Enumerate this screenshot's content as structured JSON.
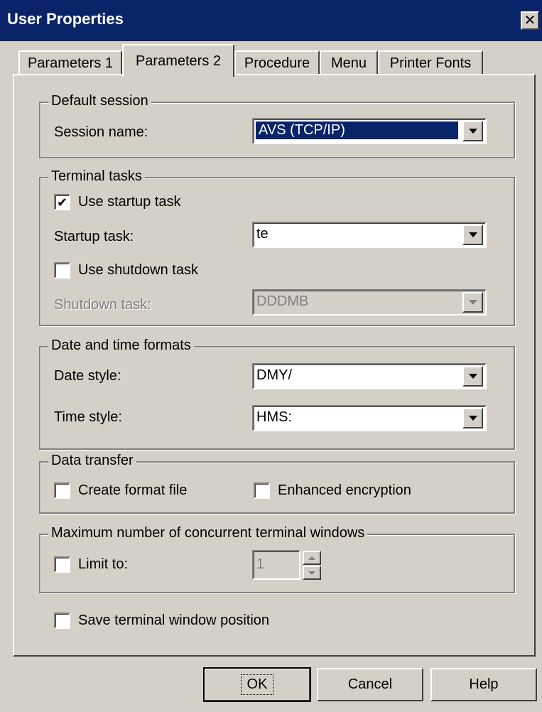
{
  "window": {
    "title": "User Properties",
    "close_glyph": "✕"
  },
  "tabs": [
    {
      "label": "Parameters 1",
      "active": false
    },
    {
      "label": "Parameters 2",
      "active": true
    },
    {
      "label": "Procedure",
      "active": false
    },
    {
      "label": "Menu",
      "active": false
    },
    {
      "label": "Printer Fonts",
      "active": false
    }
  ],
  "default_session": {
    "legend": "Default session",
    "session_name_label": "Session name:",
    "session_name_value": "AVS (TCP/IP)"
  },
  "terminal_tasks": {
    "legend": "Terminal tasks",
    "use_startup_task": {
      "label": "Use startup task",
      "checked": true
    },
    "startup_task_label": "Startup task:",
    "startup_task_value": "te",
    "use_shutdown_task": {
      "label": "Use shutdown task",
      "checked": false
    },
    "shutdown_task_label": "Shutdown task:",
    "shutdown_task_value": "DDDMB"
  },
  "date_time": {
    "legend": "Date and time formats",
    "date_style_label": "Date style:",
    "date_style_value": "DMY/",
    "time_style_label": "Time style:",
    "time_style_value": "HMS:"
  },
  "data_transfer": {
    "legend": "Data transfer",
    "create_format_file": {
      "label": "Create format file",
      "checked": false
    },
    "enhanced_encryption": {
      "label": "Enhanced encryption",
      "checked": false
    }
  },
  "max_windows": {
    "legend": "Maximum number of concurrent terminal windows",
    "limit_to": {
      "label": "Limit to:",
      "checked": false
    },
    "limit_value": "1"
  },
  "save_position": {
    "label": "Save terminal window position",
    "checked": false
  },
  "buttons": {
    "ok": "OK",
    "cancel": "Cancel",
    "help": "Help"
  },
  "icons": {
    "check": "✔"
  },
  "colors": {
    "titlebar": "#0a246a",
    "face": "#d4d0c8",
    "selection": "#0a246a"
  }
}
